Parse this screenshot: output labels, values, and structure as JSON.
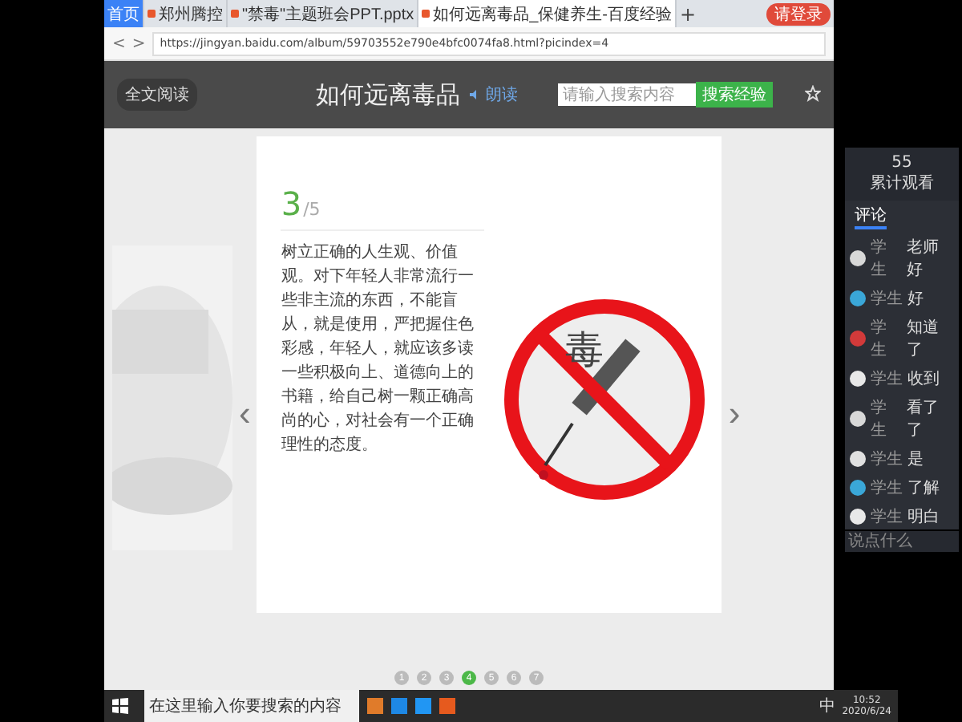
{
  "browser": {
    "tabs": [
      {
        "label": "首页",
        "kind": "home",
        "selected": false
      },
      {
        "label": "郑州腾控",
        "kind": "page",
        "selected": false
      },
      {
        "label": "\"禁毒\"主题班会PPT.pptx",
        "kind": "page",
        "selected": false
      },
      {
        "label": "如何远离毒品_保健养生-百度经验",
        "kind": "page",
        "selected": true
      }
    ],
    "new_tab": "+",
    "login": "请登录",
    "back": "<",
    "forward": ">",
    "address": "https://jingyan.baidu.com/album/59703552e790e4bfc0074fa8.html?picindex=4"
  },
  "header": {
    "full_text": "全文阅读",
    "title": "如何远离毒品",
    "read_aloud": "朗读",
    "search": {
      "placeholder": "请输入搜索内容"
    },
    "search_button": "搜索经验"
  },
  "slide": {
    "current": "3",
    "total": "/5",
    "text": "树立正确的人生观、价值观。对下年轻人非常流行一些非主流的东西，不能盲从，就是使用，严把握住色彩感，年轻人，就应该多读一些积极向上、道德向上的书籍，给自己树一颗正确高尚的心，对社会有一个正确理性的态度。",
    "sign_char": "毒",
    "prev": "‹",
    "next": "›"
  },
  "pager": [
    {
      "label": "1",
      "selected": false
    },
    {
      "label": "2",
      "selected": false
    },
    {
      "label": "3",
      "selected": false
    },
    {
      "label": "4",
      "selected": true
    },
    {
      "label": "5",
      "selected": false
    },
    {
      "label": "6",
      "selected": false
    },
    {
      "label": "7",
      "selected": false
    }
  ],
  "chat": {
    "count": "55",
    "count_label": "累计观看",
    "tab": "评论",
    "messages": [
      {
        "name": "学生",
        "text": "老师好",
        "color": "#d8d8d8"
      },
      {
        "name": "学生",
        "text": "好",
        "color": "#3aa7d8"
      },
      {
        "name": "学生",
        "text": "知道了",
        "color": "#d23a3a"
      },
      {
        "name": "学生",
        "text": "收到",
        "color": "#e8e8e8"
      },
      {
        "name": "学生",
        "text": "看了了",
        "color": "#d8d8d8"
      },
      {
        "name": "学生",
        "text": "是",
        "color": "#e0e0e0"
      },
      {
        "name": "学生",
        "text": "了解",
        "color": "#3aa7d8"
      },
      {
        "name": "学生",
        "text": "明白",
        "color": "#e8e8e8"
      }
    ],
    "input_placeholder": "说点什么"
  },
  "taskbar": {
    "search": {
      "placeholder": "在这里输入你要搜索的内容"
    },
    "ime": "中",
    "time": "10:52",
    "date": "2020/6/24"
  }
}
